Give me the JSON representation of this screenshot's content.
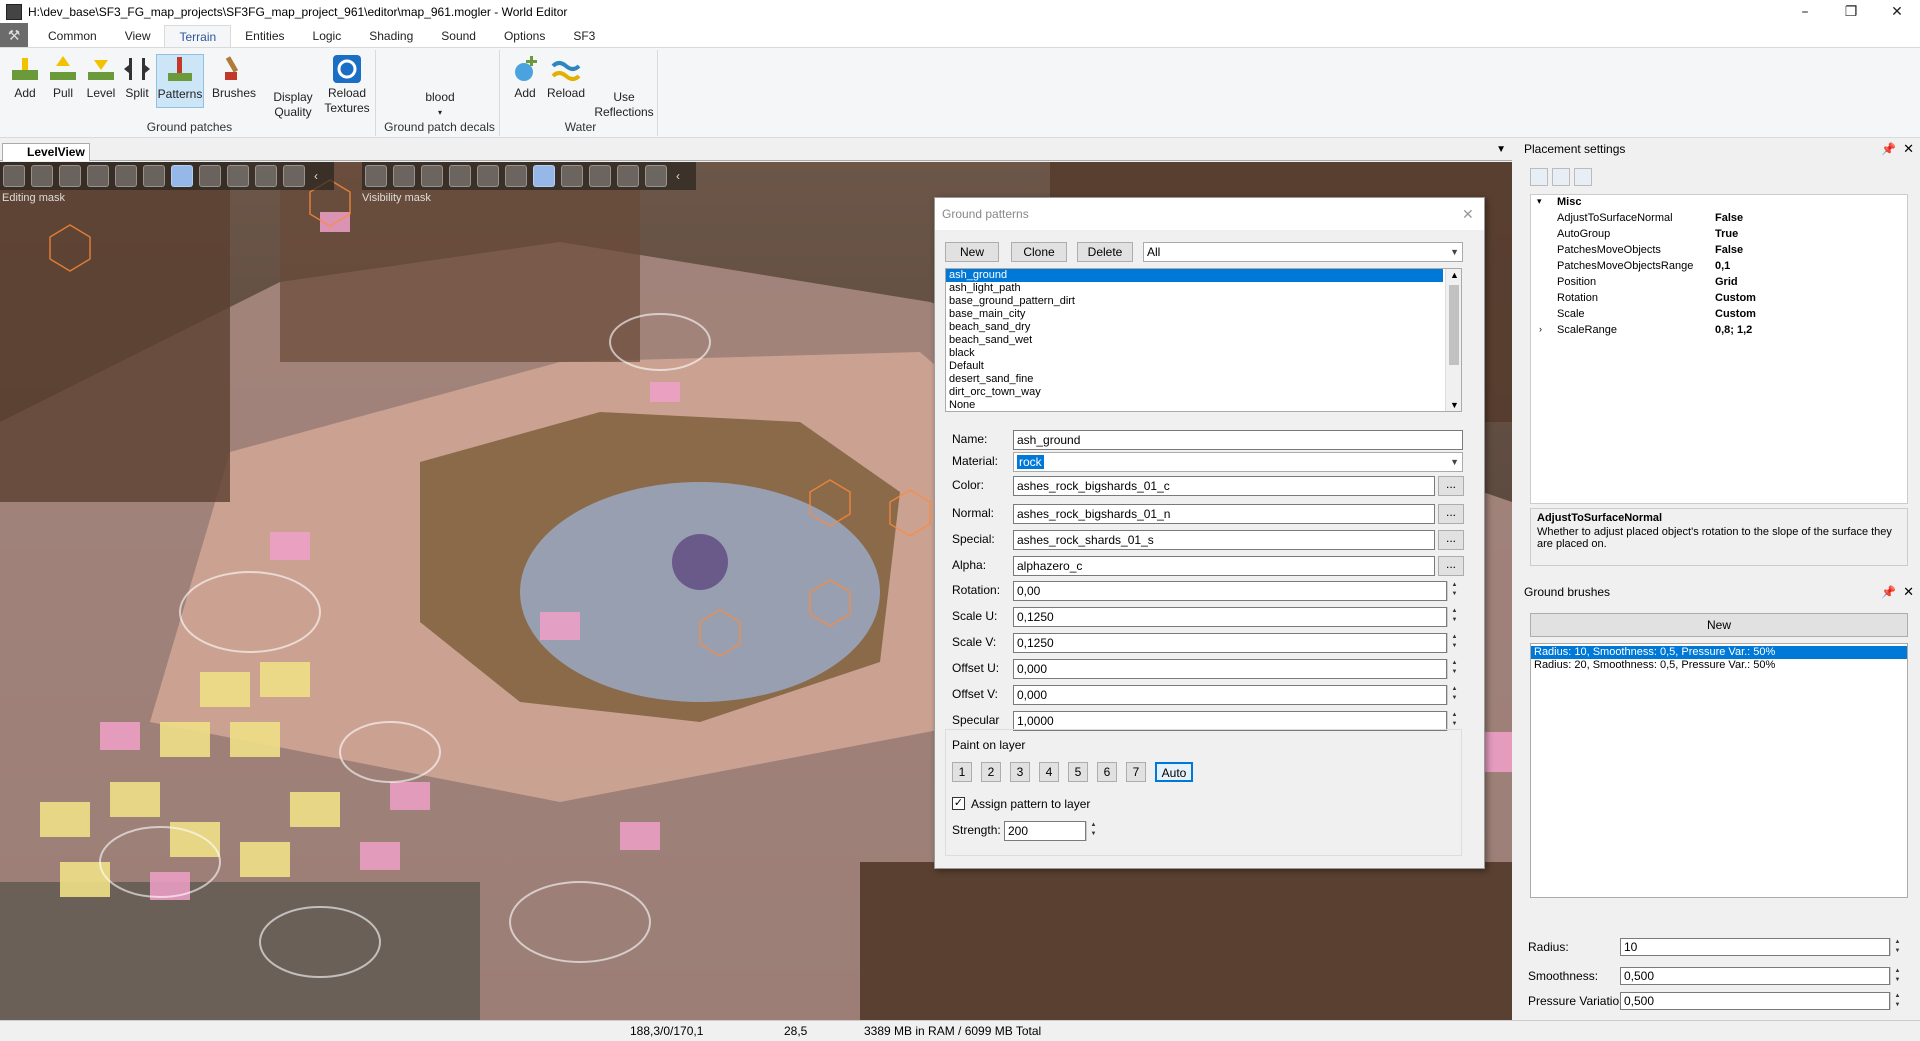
{
  "window": {
    "title": "H:\\dev_base\\SF3_FG_map_projects\\SF3FG_map_project_961\\editor\\map_961.mogler - World Editor"
  },
  "menu": {
    "tabs": [
      "Common",
      "View",
      "Terrain",
      "Entities",
      "Logic",
      "Shading",
      "Sound",
      "Options",
      "SF3"
    ],
    "active": "Terrain"
  },
  "ribbon": {
    "ground_patches": {
      "label": "Ground patches",
      "buttons": [
        "Add",
        "Pull",
        "Level",
        "Split",
        "Patterns",
        "Brushes",
        "Display",
        "Quality",
        "Reload",
        "Textures"
      ]
    },
    "decals": {
      "label": "Ground patch decals",
      "value": "blood"
    },
    "water": {
      "label": "Water",
      "buttons": [
        "Add",
        "Reload",
        "Use",
        "Reflections"
      ]
    }
  },
  "viewport": {
    "tab": "LevelView",
    "mask1": "Editing mask",
    "mask2": "Visibility mask"
  },
  "dialog": {
    "title": "Ground patterns",
    "buttons": {
      "new": "New",
      "clone": "Clone",
      "delete": "Delete"
    },
    "filter": "All",
    "patterns": [
      "ash_ground",
      "ash_light_path",
      "base_ground_pattern_dirt",
      "base_main_city",
      "beach_sand_dry",
      "beach_sand_wet",
      "black",
      "Default",
      "desert_sand_fine",
      "dirt_orc_town_way",
      "None"
    ],
    "selected_pattern": "ash_ground",
    "fields": {
      "name_label": "Name:",
      "name": "ash_ground",
      "material_label": "Material:",
      "material": "rock",
      "color_label": "Color:",
      "color": "ashes_rock_bigshards_01_c",
      "normal_label": "Normal:",
      "normal": "ashes_rock_bigshards_01_n",
      "special_label": "Special:",
      "special": "ashes_rock_shards_01_s",
      "alpha_label": "Alpha:",
      "alpha": "alphazero_c",
      "rotation_label": "Rotation:",
      "rotation": "0,00",
      "scaleu_label": "Scale U:",
      "scaleu": "0,1250",
      "scalev_label": "Scale V:",
      "scalev": "0,1250",
      "offsetu_label": "Offset U:",
      "offsetu": "0,000",
      "offsetv_label": "Offset V:",
      "offsetv": "0,000",
      "specular_label": "Specular",
      "specular": "1,0000"
    },
    "ellipsis": "...",
    "paint": {
      "label": "Paint on layer",
      "layers": [
        "1",
        "2",
        "3",
        "4",
        "5",
        "6",
        "7",
        "Auto"
      ],
      "selected": "Auto",
      "assign_label": "Assign pattern to layer",
      "assign_checked": true,
      "strength_label": "Strength:",
      "strength": "200"
    }
  },
  "placement": {
    "title": "Placement settings",
    "category": "Misc",
    "properties": [
      {
        "name": "AdjustToSurfaceNormal",
        "value": "False"
      },
      {
        "name": "AutoGroup",
        "value": "True"
      },
      {
        "name": "PatchesMoveObjects",
        "value": "False"
      },
      {
        "name": "PatchesMoveObjectsRange",
        "value": "0,1"
      },
      {
        "name": "Position",
        "value": "Grid"
      },
      {
        "name": "Rotation",
        "value": "Custom"
      },
      {
        "name": "Scale",
        "value": "Custom"
      },
      {
        "name": "ScaleRange",
        "value": "0,8; 1,2"
      }
    ],
    "desc_title": "AdjustToSurfaceNormal",
    "desc_text": "Whether to adjust placed object's rotation to the slope of the surface they are placed on."
  },
  "brushes": {
    "title": "Ground brushes",
    "new": "New",
    "items": [
      "Radius: 10, Smoothness: 0,5, Pressure Var.: 50%",
      "Radius: 20, Smoothness: 0,5, Pressure Var.: 50%"
    ],
    "radius_label": "Radius:",
    "radius": "10",
    "smooth_label": "Smoothness:",
    "smooth": "0,500",
    "pressure_label": "Pressure Variation:",
    "pressure": "0,500"
  },
  "status": {
    "coords": "188,3/0/170,1",
    "value": "28,5",
    "memory": "3389 MB in RAM / 6099 MB Total"
  },
  "colors": {
    "accent": "#0078d7",
    "ribbon_tab": "#2b579a"
  }
}
